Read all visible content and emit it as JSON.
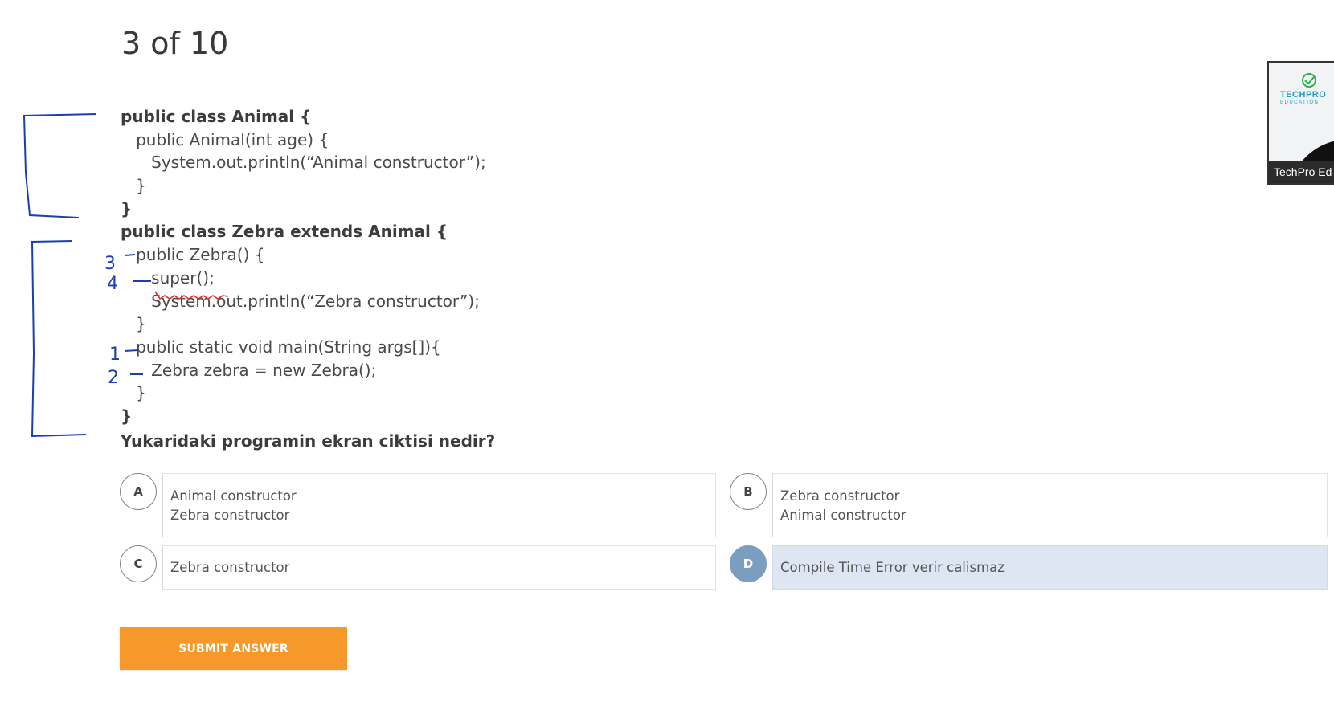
{
  "progress": {
    "label": "3 of 10"
  },
  "code_lines": [
    "public class Animal {",
    "   public Animal(int age) {",
    "      System.out.println(“Animal constructor”);",
    "   }",
    "}",
    "public class Zebra extends Animal {",
    "   public Zebra() {",
    "      super();",
    "      System.out.println(“Zebra constructor”);",
    "   }",
    "   public static void main(String args[]){",
    "      Zebra zebra = new Zebra();",
    "   }",
    "}"
  ],
  "question": "Yukaridaki programin ekran ciktisi nedir?",
  "options": [
    {
      "letter": "A",
      "lines": [
        "Animal constructor",
        "Zebra constructor"
      ],
      "selected": false
    },
    {
      "letter": "B",
      "lines": [
        "Zebra constructor",
        "Animal constructor"
      ],
      "selected": false
    },
    {
      "letter": "C",
      "lines": [
        "Zebra constructor"
      ],
      "selected": false
    },
    {
      "letter": "D",
      "lines": [
        "Compile Time Error verir calismaz"
      ],
      "selected": true
    }
  ],
  "submit_label": "SUBMIT ANSWER",
  "webcam": {
    "name": "TechPro Ed",
    "logo_text": "TECHPRO",
    "logo_sub": "EDUCATION"
  },
  "annotations": {
    "step_numbers": [
      "3",
      "4",
      "1",
      "2"
    ]
  },
  "colors": {
    "accent_orange": "#f7992a",
    "selected_blue": "#7b9dbf",
    "selected_bg": "#dde6f2",
    "pen_blue": "#1a3fb3",
    "pen_red": "#e03030"
  }
}
